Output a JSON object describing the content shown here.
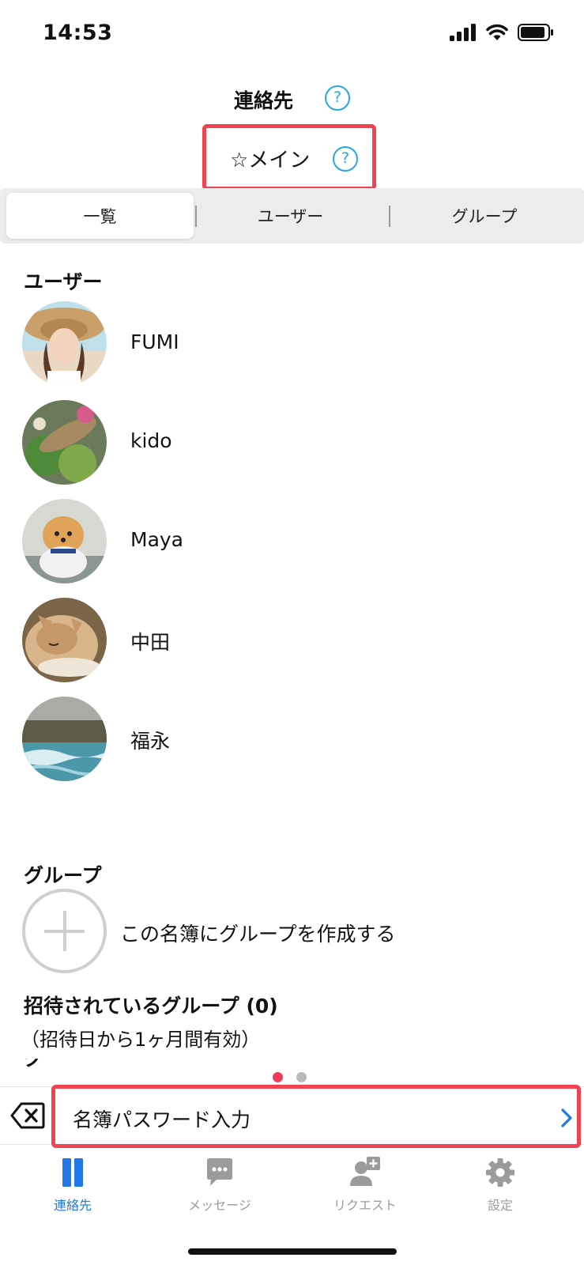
{
  "status_bar": {
    "time": "14:53"
  },
  "header": {
    "title": "連絡先",
    "help_symbol": "?"
  },
  "book_selector": {
    "name": "☆メイン",
    "help_symbol": "?"
  },
  "segments": [
    {
      "label": "一覧",
      "selected": true
    },
    {
      "label": "ユーザー",
      "selected": false
    },
    {
      "label": "グループ",
      "selected": false
    }
  ],
  "users_section": {
    "title": "ユーザー",
    "users": [
      {
        "name": "FUMI"
      },
      {
        "name": "kido"
      },
      {
        "name": "Maya"
      },
      {
        "name": "中田"
      },
      {
        "name": "福永"
      }
    ]
  },
  "groups_section": {
    "title": "グループ",
    "create_label": "この名簿にグループを作成する"
  },
  "invited_section": {
    "title": "招待されているグループ (0)",
    "note": "（招待日から1ヶ月間有効）"
  },
  "pager": {
    "pages": 2,
    "current": 1
  },
  "password_bar": {
    "label": "名簿パスワード入力"
  },
  "tab_bar": {
    "items": [
      {
        "label": "連絡先",
        "icon": "contacts-icon",
        "active": true
      },
      {
        "label": "メッセージ",
        "icon": "message-icon",
        "active": false
      },
      {
        "label": "リクエスト",
        "icon": "request-icon",
        "active": false
      },
      {
        "label": "設定",
        "icon": "gear-icon",
        "active": false
      }
    ]
  },
  "colors": {
    "accent_blue": "#1f78e6",
    "help_blue": "#29a4e6",
    "highlight_red": "#f0424f",
    "dot_active": "#ef3a5d"
  }
}
